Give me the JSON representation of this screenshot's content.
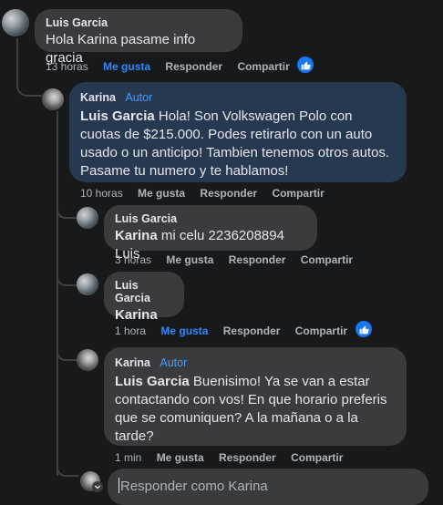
{
  "comments": [
    {
      "author": "Luis Garcia",
      "badge": "",
      "mention": "",
      "text": "Hola Karina pasame info gracia",
      "time": "13 horas",
      "like": "Me gusta",
      "reply": "Responder",
      "share": "Compartir",
      "liked": true
    },
    {
      "author": "Karina",
      "badge": "Autor",
      "mention": "Luis Garcia",
      "text": "Hola! Son Volkswagen Polo con cuotas de $215.000. Podes retirarlo con un auto usado o un anticipo! Tambien tenemos otros autos. Pasame tu numero y te hablamos!",
      "time": "10 horas",
      "like": "Me gusta",
      "reply": "Responder",
      "share": "Compartir",
      "liked": false
    },
    {
      "author": "Luis Garcia",
      "badge": "",
      "mention": "Karina",
      "text": "mi celu 2236208894 Luis",
      "time": "3 horas",
      "like": "Me gusta",
      "reply": "Responder",
      "share": "Compartir",
      "liked": false
    },
    {
      "author": "Luis Garcia",
      "badge": "",
      "mention": "Karina",
      "text": "",
      "time": "1 hora",
      "like": "Me gusta",
      "reply": "Responder",
      "share": "Compartir",
      "liked": true
    },
    {
      "author": "Karina",
      "badge": "Autor",
      "mention": "Luis Garcia",
      "text": "Buenisimo! Ya se van a estar contactando con vos! En que horario preferis que se comuniquen? A la mañana o a la tarde?",
      "time": "1 min",
      "like": "Me gusta",
      "reply": "Responder",
      "share": "Compartir",
      "liked": false
    }
  ],
  "reply_box": {
    "placeholder": "Responder como Karina"
  },
  "colors": {
    "background": "#18191a",
    "bubble": "#3a3b3c",
    "author_bubble": "#263951",
    "accent": "#2d88ff"
  }
}
